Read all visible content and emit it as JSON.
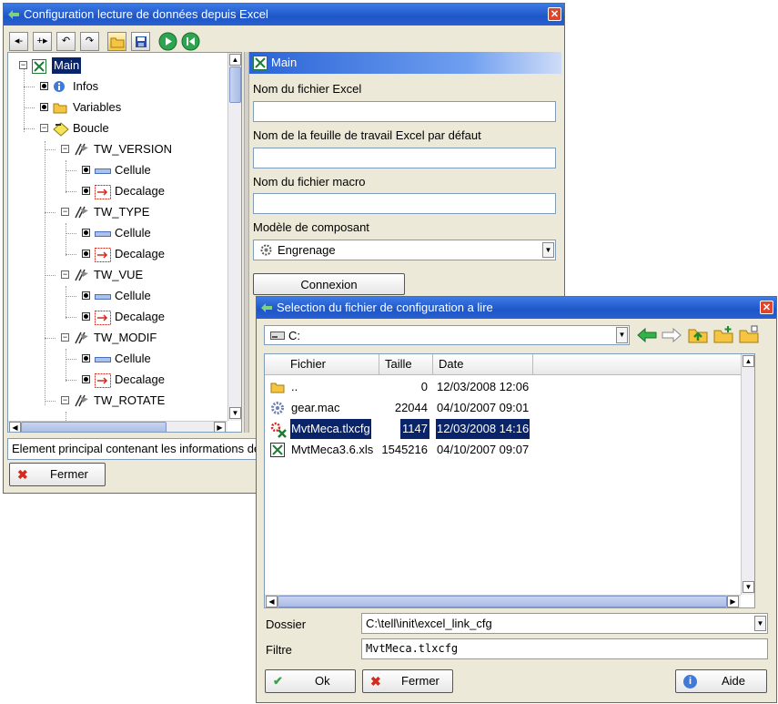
{
  "main_window": {
    "title": "Configuration lecture de données depuis Excel",
    "tree": [
      {
        "label": "Main",
        "selected": true,
        "icon": "excel-icon"
      },
      {
        "label": "Infos",
        "icon": "info-icon"
      },
      {
        "label": "Variables",
        "icon": "folder-icon"
      },
      {
        "label": "Boucle",
        "icon": "loop-icon"
      },
      {
        "label": "TW_VERSION",
        "icon": "tw-icon"
      },
      {
        "label": "Cellule",
        "icon": "cell-icon"
      },
      {
        "label": "Decalage",
        "icon": "offset-icon"
      },
      {
        "label": "TW_TYPE",
        "icon": "tw-icon"
      },
      {
        "label": "Cellule",
        "icon": "cell-icon"
      },
      {
        "label": "Decalage",
        "icon": "offset-icon"
      },
      {
        "label": "TW_VUE",
        "icon": "tw-icon"
      },
      {
        "label": "Cellule",
        "icon": "cell-icon"
      },
      {
        "label": "Decalage",
        "icon": "offset-icon"
      },
      {
        "label": "TW_MODIF",
        "icon": "tw-icon"
      },
      {
        "label": "Cellule",
        "icon": "cell-icon"
      },
      {
        "label": "Decalage",
        "icon": "offset-icon"
      },
      {
        "label": "TW_ROTATE",
        "icon": "tw-icon"
      }
    ],
    "form": {
      "header": "Main",
      "excel_file_label": "Nom du fichier Excel",
      "excel_file_value": "",
      "sheet_label": "Nom de la feuille de travail Excel par défaut",
      "sheet_value": "",
      "macro_label": "Nom du fichier macro",
      "macro_value": "",
      "component_label": "Modèle de composant",
      "component_value": "Engrenage",
      "connect_button": "Connexion"
    },
    "status_text": "Element principal contenant les informations de",
    "close_button": "Fermer"
  },
  "dialog": {
    "title": "Selection du fichier de configuration a lire",
    "drive": "C:",
    "columns": [
      "Fichier",
      "Taille",
      "Date"
    ],
    "files": [
      {
        "name": "..",
        "size": "0",
        "date": "12/03/2008 12:06",
        "icon": "folder-icon",
        "selected": false
      },
      {
        "name": "gear.mac",
        "size": "22044",
        "date": "04/10/2007 09:01",
        "icon": "gear-file-icon",
        "selected": false
      },
      {
        "name": "MvtMeca.tlxcfg",
        "size": "1147",
        "date": "12/03/2008 14:16",
        "icon": "config-file-icon",
        "selected": true
      },
      {
        "name": "MvtMeca3.6.xls",
        "size": "1545216",
        "date": "04/10/2007 09:07",
        "icon": "excel-file-icon",
        "selected": false
      }
    ],
    "folder_label": "Dossier",
    "folder_value": "C:\\tell\\init\\excel_link_cfg",
    "filter_label": "Filtre",
    "filter_value": "MvtMeca.tlxcfg",
    "ok_button": "Ok",
    "cancel_button": "Fermer",
    "help_button": "Aide"
  },
  "colors": {
    "title_blue": "#1e56c8",
    "selection": "#0a246a",
    "window_bg": "#ece9d8"
  }
}
